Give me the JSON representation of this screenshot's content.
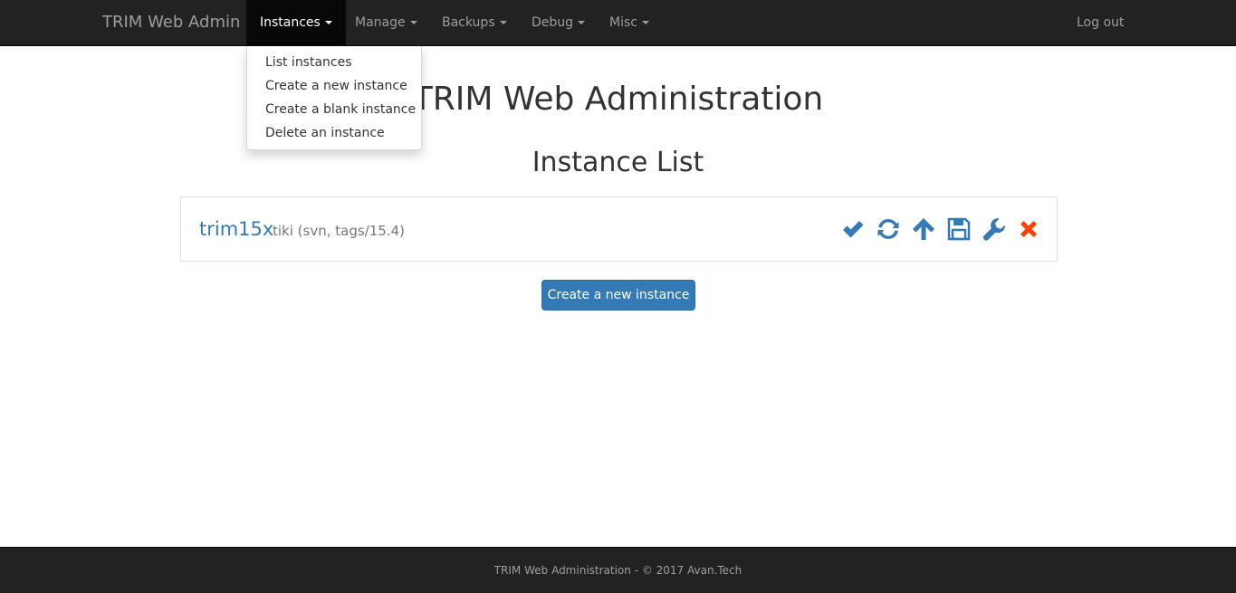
{
  "navbar": {
    "brand": "TRIM Web Admin",
    "menus": [
      {
        "label": "Instances",
        "active": true
      },
      {
        "label": "Manage",
        "active": false
      },
      {
        "label": "Backups",
        "active": false
      },
      {
        "label": "Debug",
        "active": false
      },
      {
        "label": "Misc",
        "active": false
      }
    ],
    "logout": "Log out"
  },
  "dropdown": {
    "items": [
      {
        "label": "List instances"
      },
      {
        "label": "Create a new instance"
      },
      {
        "label": "Create a blank instance"
      },
      {
        "label": "Delete an instance"
      }
    ]
  },
  "main": {
    "title": "TRIM Web Administration",
    "subtitle": "Instance List",
    "instances": [
      {
        "name": "trim15x",
        "description": "tiki (svn, tags/15.4)",
        "actions": [
          "check-icon",
          "refresh-icon",
          "arrow-up-icon",
          "save-icon",
          "wrench-icon",
          "delete-x-icon"
        ]
      }
    ],
    "create_button": "Create a new instance"
  },
  "footer": {
    "text": "TRIM Web Administration - © 2017 Avan.Tech"
  },
  "colors": {
    "navbar_bg": "#222222",
    "link": "#337ab7",
    "danger": "#ff4000",
    "primary_button": "#337ab7"
  }
}
